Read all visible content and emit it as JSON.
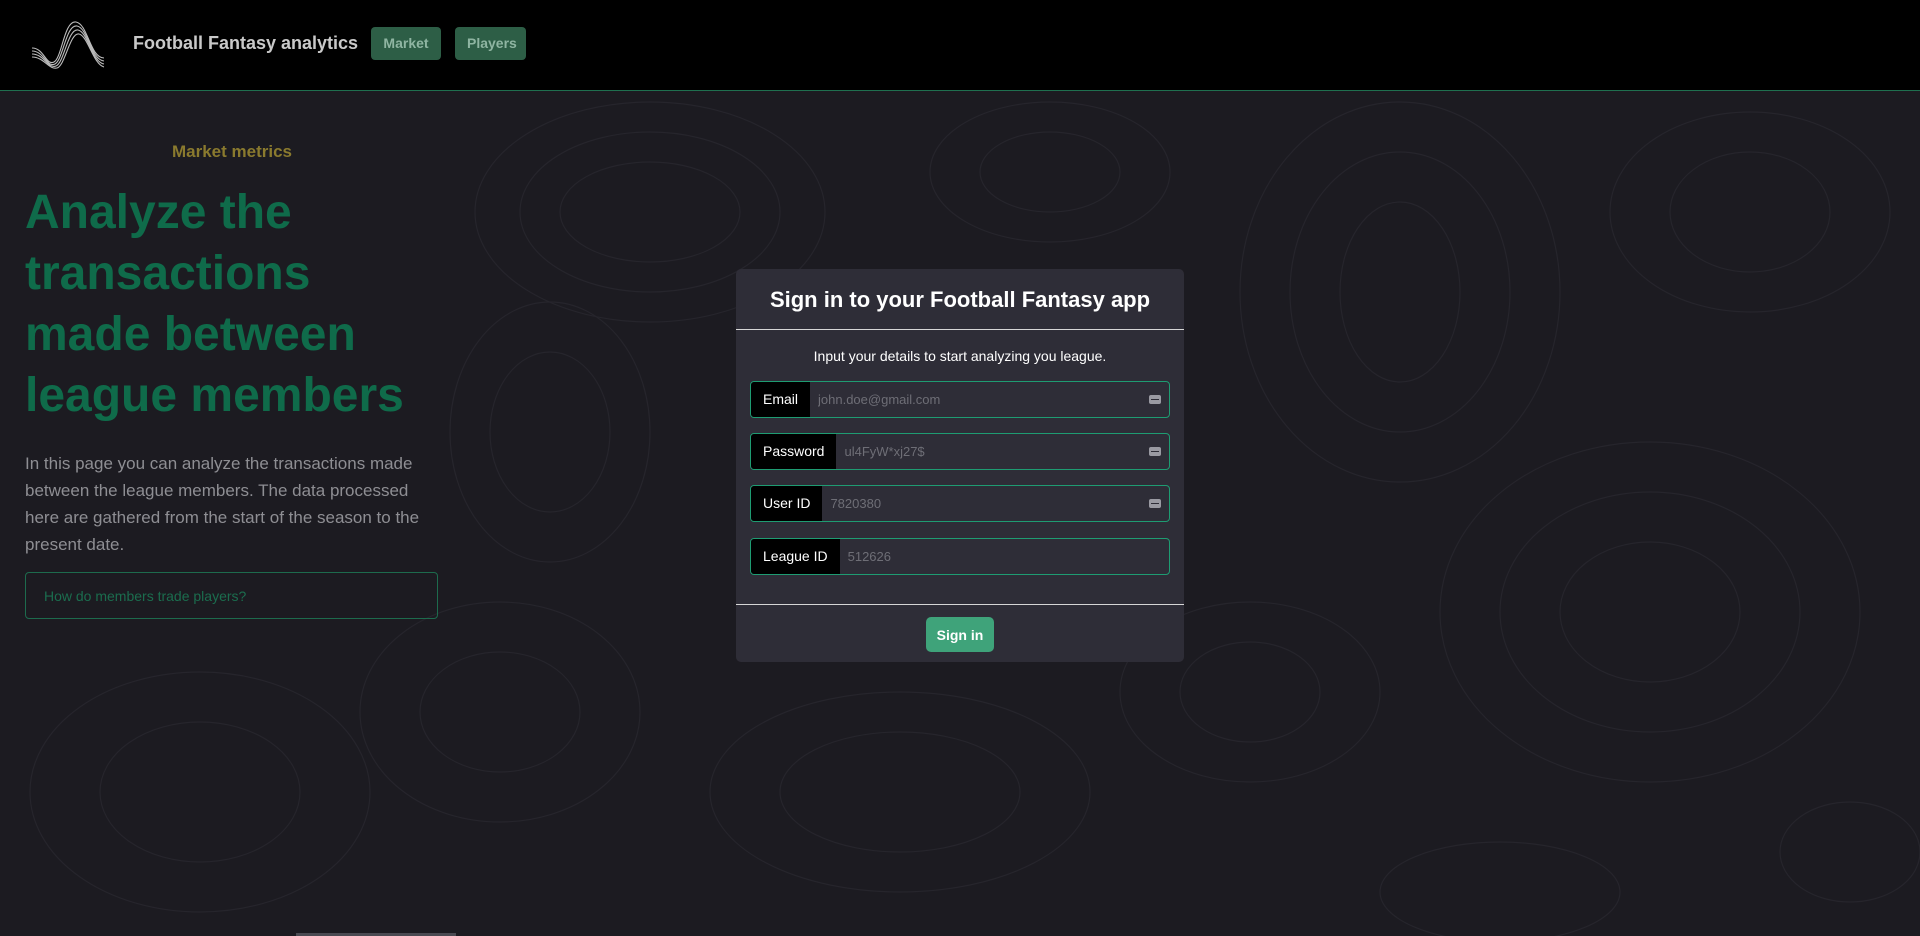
{
  "header": {
    "brand": "Football Fantasy analytics",
    "nav": [
      {
        "label": "Market"
      },
      {
        "label": "Players"
      }
    ]
  },
  "hero": {
    "eyebrow": "Market metrics",
    "headline": "Analyze the transactions made between league members",
    "description": "In this page you can analyze the transactions made between the league members. The data processed here are gathered from the start of the season to the present date.",
    "question_button": "How do members trade players?"
  },
  "signin": {
    "title": "Sign in to your Football Fantasy app",
    "subtitle": "Input your details to start analyzing you league.",
    "fields": {
      "email": {
        "label": "Email",
        "placeholder": "john.doe@gmail.com"
      },
      "password": {
        "label": "Password",
        "placeholder": "ul4FyW*xj27$"
      },
      "user_id": {
        "label": "User ID",
        "placeholder": "7820380"
      },
      "league_id": {
        "label": "League ID",
        "placeholder": "512626"
      }
    },
    "submit_label": "Sign in"
  },
  "colors": {
    "background": "#1c1b21",
    "topbar": "#000000",
    "accent_green": "#0f6b4a",
    "button_green": "#3fa37a",
    "nav_button": "#2d5e46",
    "eyebrow_gold": "#8a7a2e",
    "card": "#2e2d37"
  },
  "icons": {
    "logo": "wave-lines-logo",
    "field_autofill": "keyboard-autofill-icon"
  }
}
